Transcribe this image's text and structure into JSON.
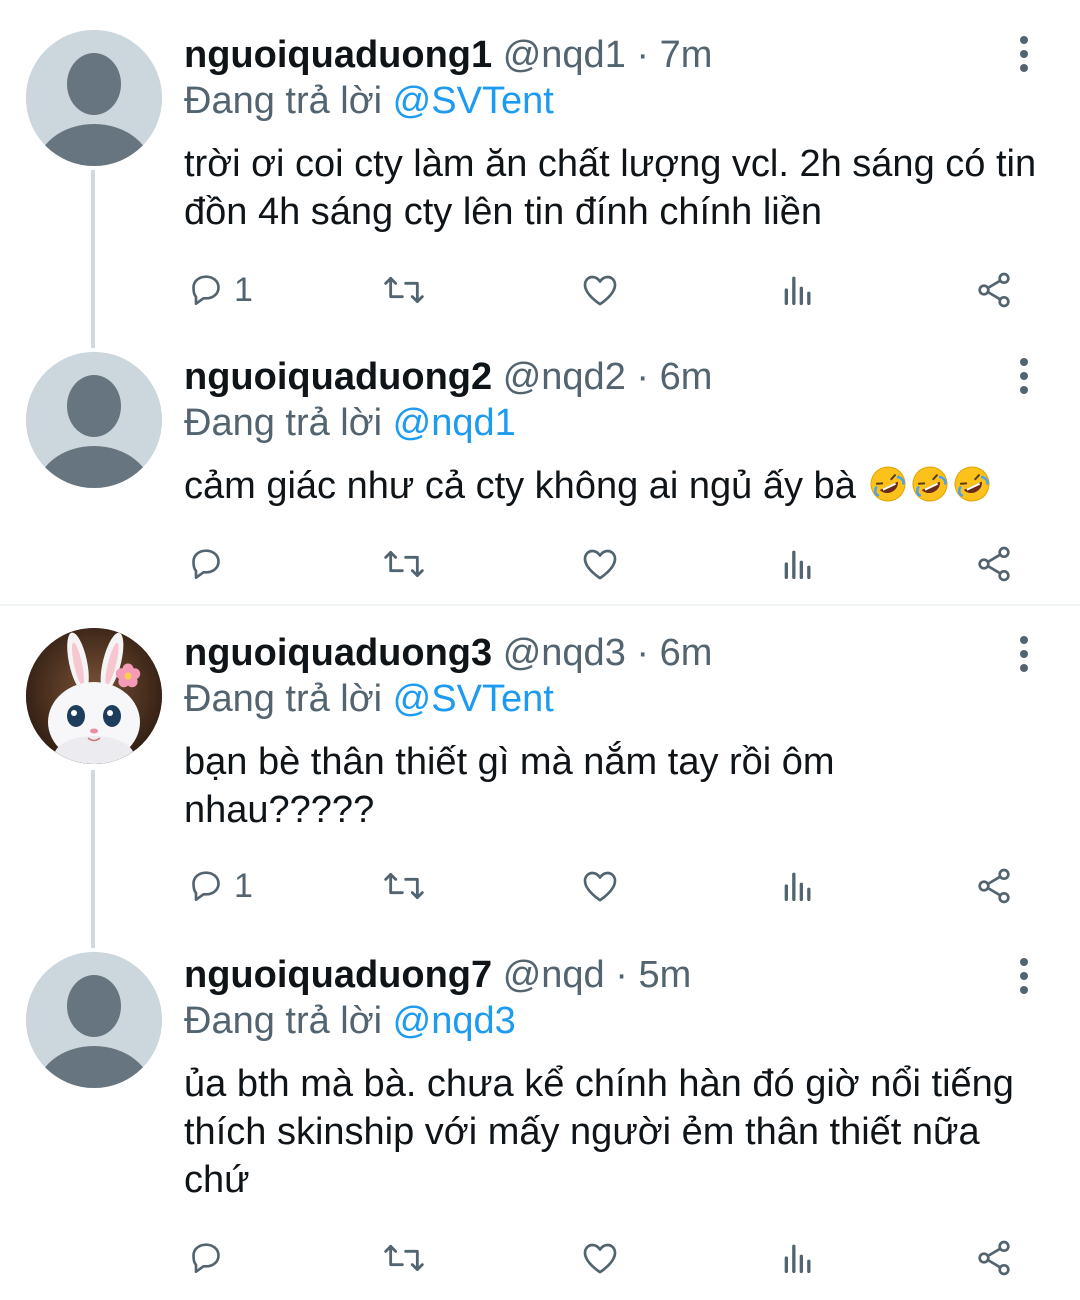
{
  "colors": {
    "text": "#0f1419",
    "secondary": "#536471",
    "link": "#1d9bf0",
    "avatar_bg": "#ccd6dd",
    "avatar_fg": "#66757f"
  },
  "reply_prefix": "Đang trả lời",
  "tweets": [
    {
      "name": "nguoiquaduong1",
      "handle": "@nqd1",
      "sep": "·",
      "time": "7m",
      "reply_to": "@SVTent",
      "text": "trời ơi coi cty làm ăn chất lượng vcl. 2h sáng có tin đồn 4h sáng cty lên tin đính chính liền",
      "emoji_icon": "",
      "reply_count": "1",
      "avatar_icon": "default-avatar-icon"
    },
    {
      "name": "nguoiquaduong2",
      "handle": "@nqd2",
      "sep": "·",
      "time": "6m",
      "reply_to": "@nqd1",
      "text": "cảm giác như cả cty không ai ngủ ấy bà",
      "emoji_icon": "rolling-on-floor-laughing-emoji",
      "reply_count": "",
      "avatar_icon": "default-avatar-icon"
    },
    {
      "name": "nguoiquaduong3",
      "handle": "@nqd3",
      "sep": "·",
      "time": "6m",
      "reply_to": "@SVTent",
      "text": "bạn bè thân thiết gì mà nắm tay rồi ôm nhau?????",
      "emoji_icon": "",
      "reply_count": "1",
      "avatar_icon": "white-rabbit-avatar-icon"
    },
    {
      "name": "nguoiquaduong7",
      "handle": "@nqd",
      "sep": "·",
      "time": "5m",
      "reply_to": "@nqd3",
      "text": "ủa bth mà bà. chưa kể chính hàn đó giờ nổi tiếng thích skinship với mấy người ẻm thân thiết nữa chứ",
      "emoji_icon": "",
      "reply_count": "",
      "avatar_icon": "default-avatar-icon"
    }
  ],
  "action_icons": [
    "reply-icon",
    "retweet-icon",
    "like-icon",
    "analytics-icon",
    "share-icon"
  ]
}
